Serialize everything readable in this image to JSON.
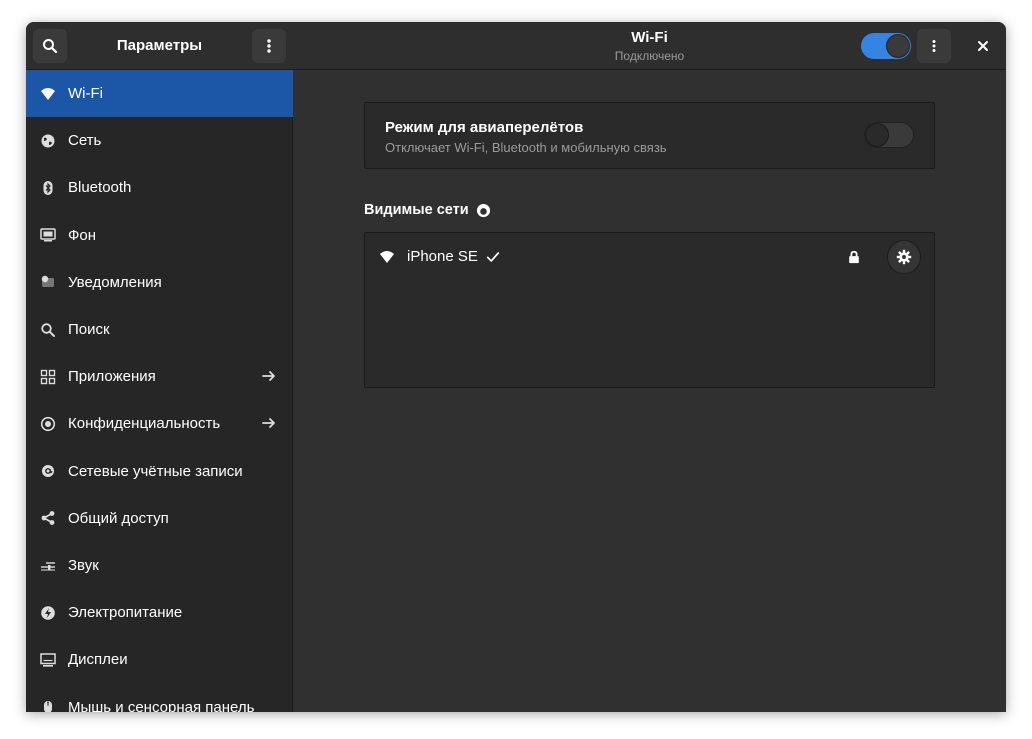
{
  "sidebar": {
    "title": "Параметры",
    "items": [
      {
        "label": "Wi-Fi",
        "icon": "wifi-icon",
        "active": true
      },
      {
        "label": "Сеть",
        "icon": "globe-icon"
      },
      {
        "label": "Bluetooth",
        "icon": "bluetooth-icon"
      },
      {
        "label": "Фон",
        "icon": "monitor-icon"
      },
      {
        "label": "Уведомления",
        "icon": "notification-icon"
      },
      {
        "label": "Поиск",
        "icon": "search-icon"
      },
      {
        "label": "Приложения",
        "icon": "apps-grid-icon",
        "arrow": true
      },
      {
        "label": "Конфиденциальность",
        "icon": "privacy-icon",
        "arrow": true
      },
      {
        "label": "Сетевые учётные записи",
        "icon": "at-icon"
      },
      {
        "label": "Общий доступ",
        "icon": "share-icon"
      },
      {
        "label": "Звук",
        "icon": "sound-icon"
      },
      {
        "label": "Электропитание",
        "icon": "power-icon"
      },
      {
        "label": "Дисплеи",
        "icon": "display-icon"
      },
      {
        "label": "Мышь и сенсорная панель",
        "icon": "mouse-icon"
      }
    ]
  },
  "header": {
    "title": "Wi-Fi",
    "subtitle": "Подключено",
    "wifi_enabled": true
  },
  "airplane": {
    "title": "Режим для авиаперелётов",
    "subtitle": "Отключает Wi-Fi, Bluetooth и мобильную связь",
    "enabled": false
  },
  "networks": {
    "label": "Видимые сети",
    "items": [
      {
        "name": "iPhone SE",
        "connected": true,
        "secured": true
      }
    ]
  },
  "colors": {
    "accent": "#1c56a6",
    "switch_on": "#3584e4"
  }
}
